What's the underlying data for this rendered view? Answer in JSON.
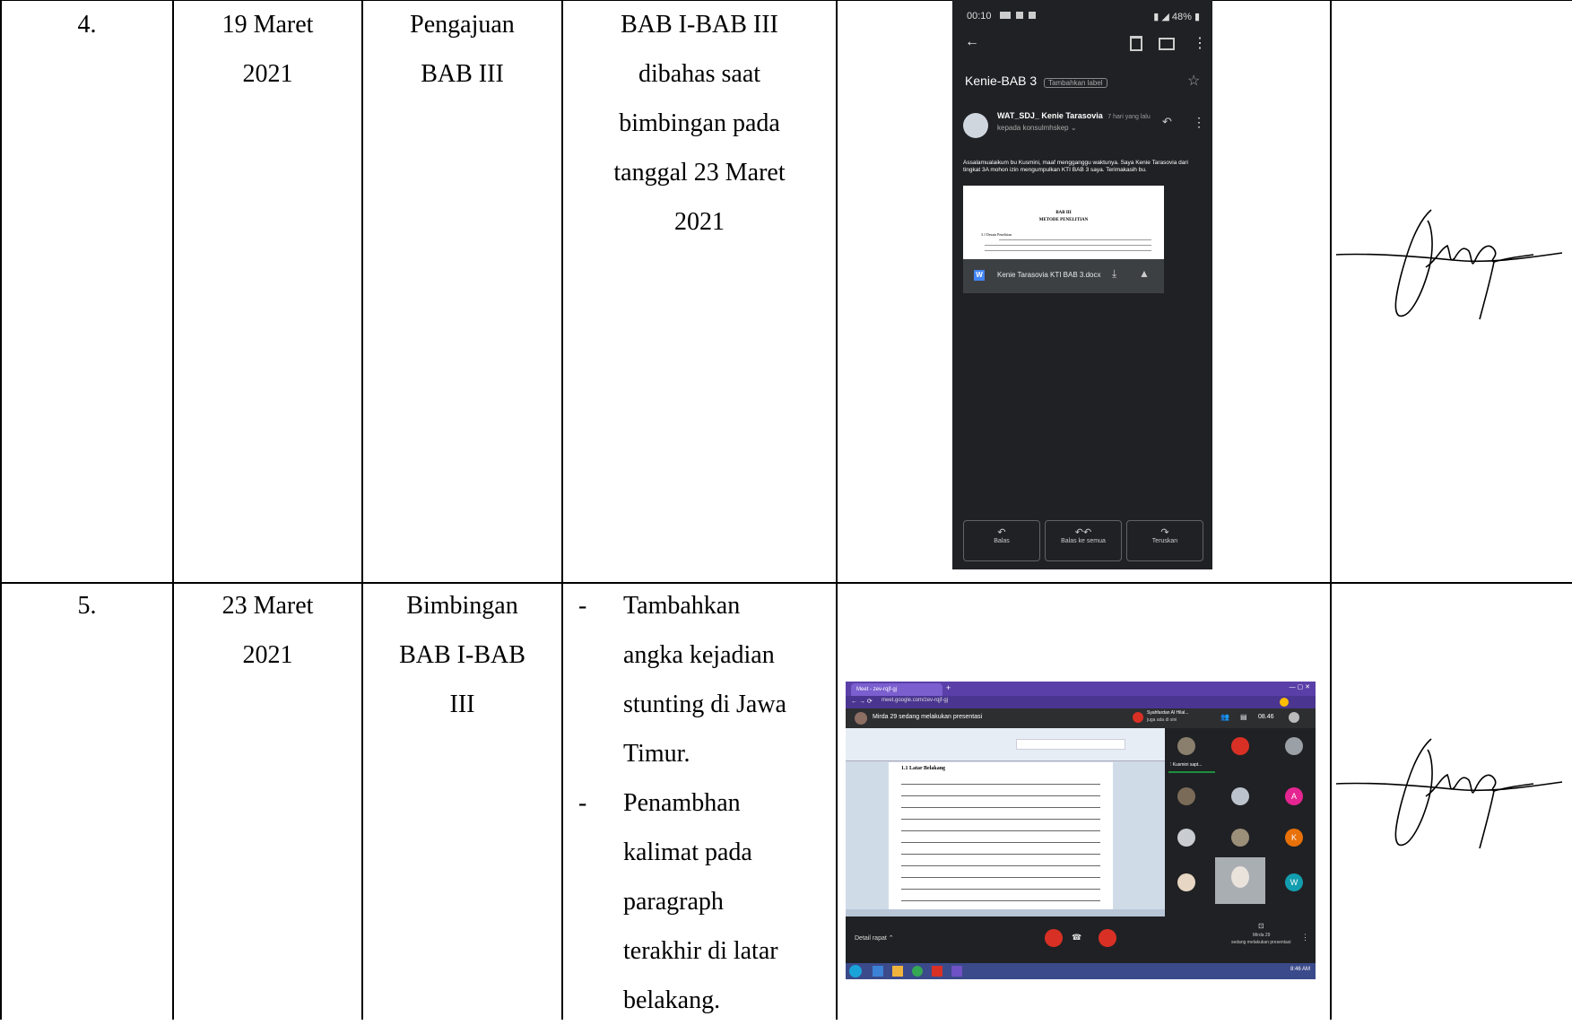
{
  "rows": [
    {
      "no": "4.",
      "date_lines": [
        "19 Maret",
        "2021"
      ],
      "activity_lines": [
        "Pengajuan",
        "BAB III"
      ],
      "notes_lines": [
        "BAB I-BAB III",
        "dibahas saat",
        "bimbingan pada",
        "tanggal 23 Maret",
        "2021"
      ],
      "evidence": {
        "status_time": "00:10",
        "status_right": "48%",
        "subject": "Kenie-BAB 3",
        "label_chip": "Tambahkan label",
        "sender": "WAT_SDJ_ Kenie Tarasovia",
        "sent_ago": "7 hari yang lalu",
        "recipient": "kepada konsulmhskep",
        "body_text": "Assalamualaikum bu Kusmini, maaf mengganggu waktunya. Saya Kenie Tarasovia dari tingkat 3A mohon izin mengumpulkan KTI BAB 3 saya. Terimakasih bu.",
        "doc_title": "BAB III",
        "doc_subtitle": "METODE PENELITIAN",
        "doc_section": "3.1 Desain Penelitian",
        "attachment_name": "Kenie Tarasovia KTI BAB 3.docx",
        "attachment_badge": "W",
        "actions": [
          "Balas",
          "Balas ke semua",
          "Teruskan"
        ]
      }
    },
    {
      "no": "5.",
      "date_lines": [
        "23 Maret",
        "2021"
      ],
      "activity_lines": [
        "Bimbingan",
        "BAB I-BAB",
        "III"
      ],
      "notes": [
        {
          "dash": "-",
          "lines": [
            "Tambahkan",
            "angka kejadian",
            "stunting di Jawa",
            "Timur."
          ]
        },
        {
          "dash": "-",
          "lines": [
            "Penambhan",
            "kalimat pada",
            "paragraph",
            "terakhir di latar",
            "belakang."
          ]
        }
      ],
      "evidence": {
        "tab_title": "Meet - zev-rqjf-gj",
        "url": "meet.google.com/zev-rqjf-gj",
        "presenting_banner": "Mirda 29 sedang melakukan presentasi",
        "notice_name": "Syahfardan Al Hilal...",
        "notice_sub": "juga ada di sini",
        "clock": "08.46",
        "doc_heading": "1.1 Latar Belakang",
        "side_label": "Kusmini sapt...",
        "participant_initials": [
          "A",
          "K",
          "W"
        ],
        "meeting_details": "Detail rapat",
        "presenter_name": "Mirda 29",
        "presenter_status": "sedang melakukan presentasi",
        "taskbar_time": "8:46 AM"
      }
    }
  ],
  "colors": {
    "phone_bg": "#202124",
    "meet_bg": "#202124",
    "end_call": "#d93025",
    "chrome_tab": "#5b3fa8",
    "avatar_red": "#d93025",
    "avatar_pink": "#e52592",
    "avatar_orange": "#e8710a",
    "avatar_teal": "#129eaf"
  }
}
